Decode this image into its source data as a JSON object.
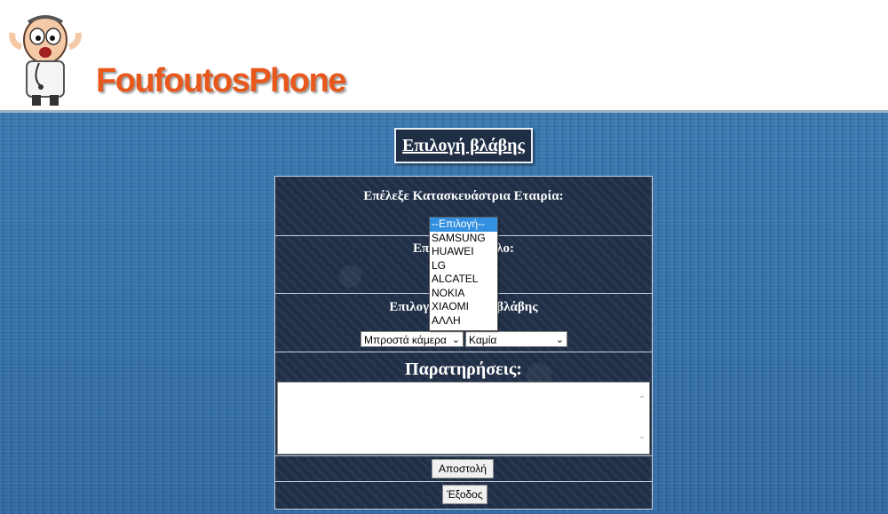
{
  "header": {
    "brand": "FoufoutosPhone"
  },
  "page": {
    "title": "Επιλογή βλάβης"
  },
  "form": {
    "manufacturer_label": "Επέλεξε Κατασκευάστρια Εταιρία:",
    "model_label_left": "Επ",
    "model_label_right": "λο:",
    "fault_label_left": "Επιλογ",
    "fault_label_right": "βλάβης",
    "component_select": "Μπροστά κάμερα",
    "fault_select": "Καμία",
    "remarks_label": "Παρατηρήσεις:",
    "remarks_value": "",
    "submit_label": "Αποστολή",
    "exit_label": "Έξοδος"
  },
  "dropdown": {
    "options": [
      "--Επιλογή--",
      "SAMSUNG",
      "HUAWEI",
      "LG",
      "ALCATEL",
      "NOKIA",
      "XIAOMI",
      "ΑΛΛΗ"
    ],
    "selected_index": 0
  },
  "icons": {
    "select_arrow": "chevron-down-icon",
    "mascot": "doctor-mascot-icon"
  },
  "colors": {
    "brand": "#e8581c",
    "background": "#2f6fa8",
    "form_bg": "#22324a",
    "highlight": "#3390e0"
  }
}
